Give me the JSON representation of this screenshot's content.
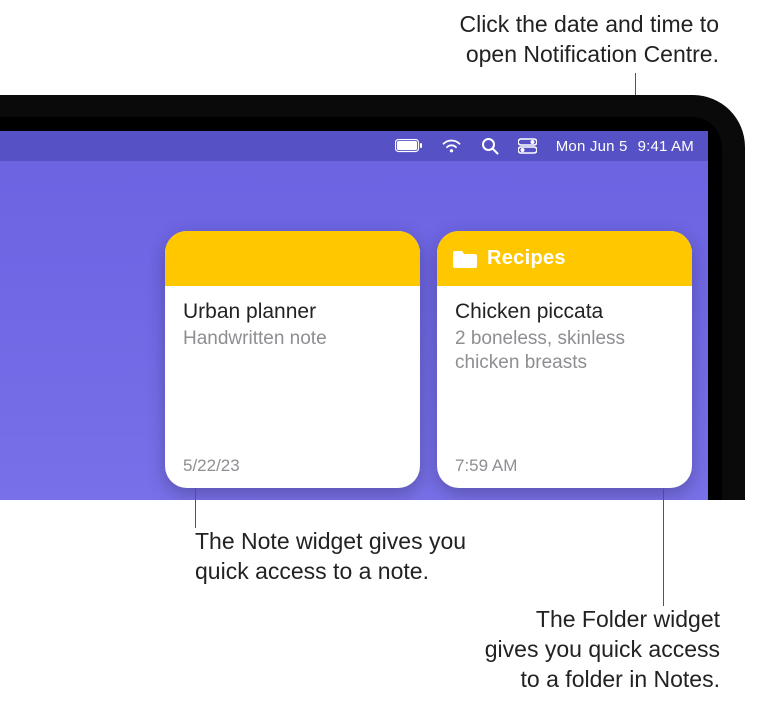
{
  "callouts": {
    "datetime_line1": "Click the date and time to",
    "datetime_line2": "open Notification Centre.",
    "note_line1": "The Note widget gives you",
    "note_line2": "quick access to a note.",
    "folder_line1": "The Folder widget",
    "folder_line2": "gives you quick access",
    "folder_line3": "to a folder in Notes."
  },
  "menubar": {
    "battery_icon": "battery-icon",
    "wifi_icon": "wifi-icon",
    "search_icon": "search-icon",
    "control_center_icon": "control-center-icon",
    "date": "Mon Jun 5",
    "time": "9:41 AM"
  },
  "widgets": {
    "note": {
      "title": "Urban planner",
      "subtitle": "Handwritten note",
      "footer": "5/22/23"
    },
    "folder": {
      "header_label": "Recipes",
      "title": "Chicken piccata",
      "subtitle": "2 boneless, skinless chicken breasts",
      "footer": "7:59 AM"
    }
  }
}
